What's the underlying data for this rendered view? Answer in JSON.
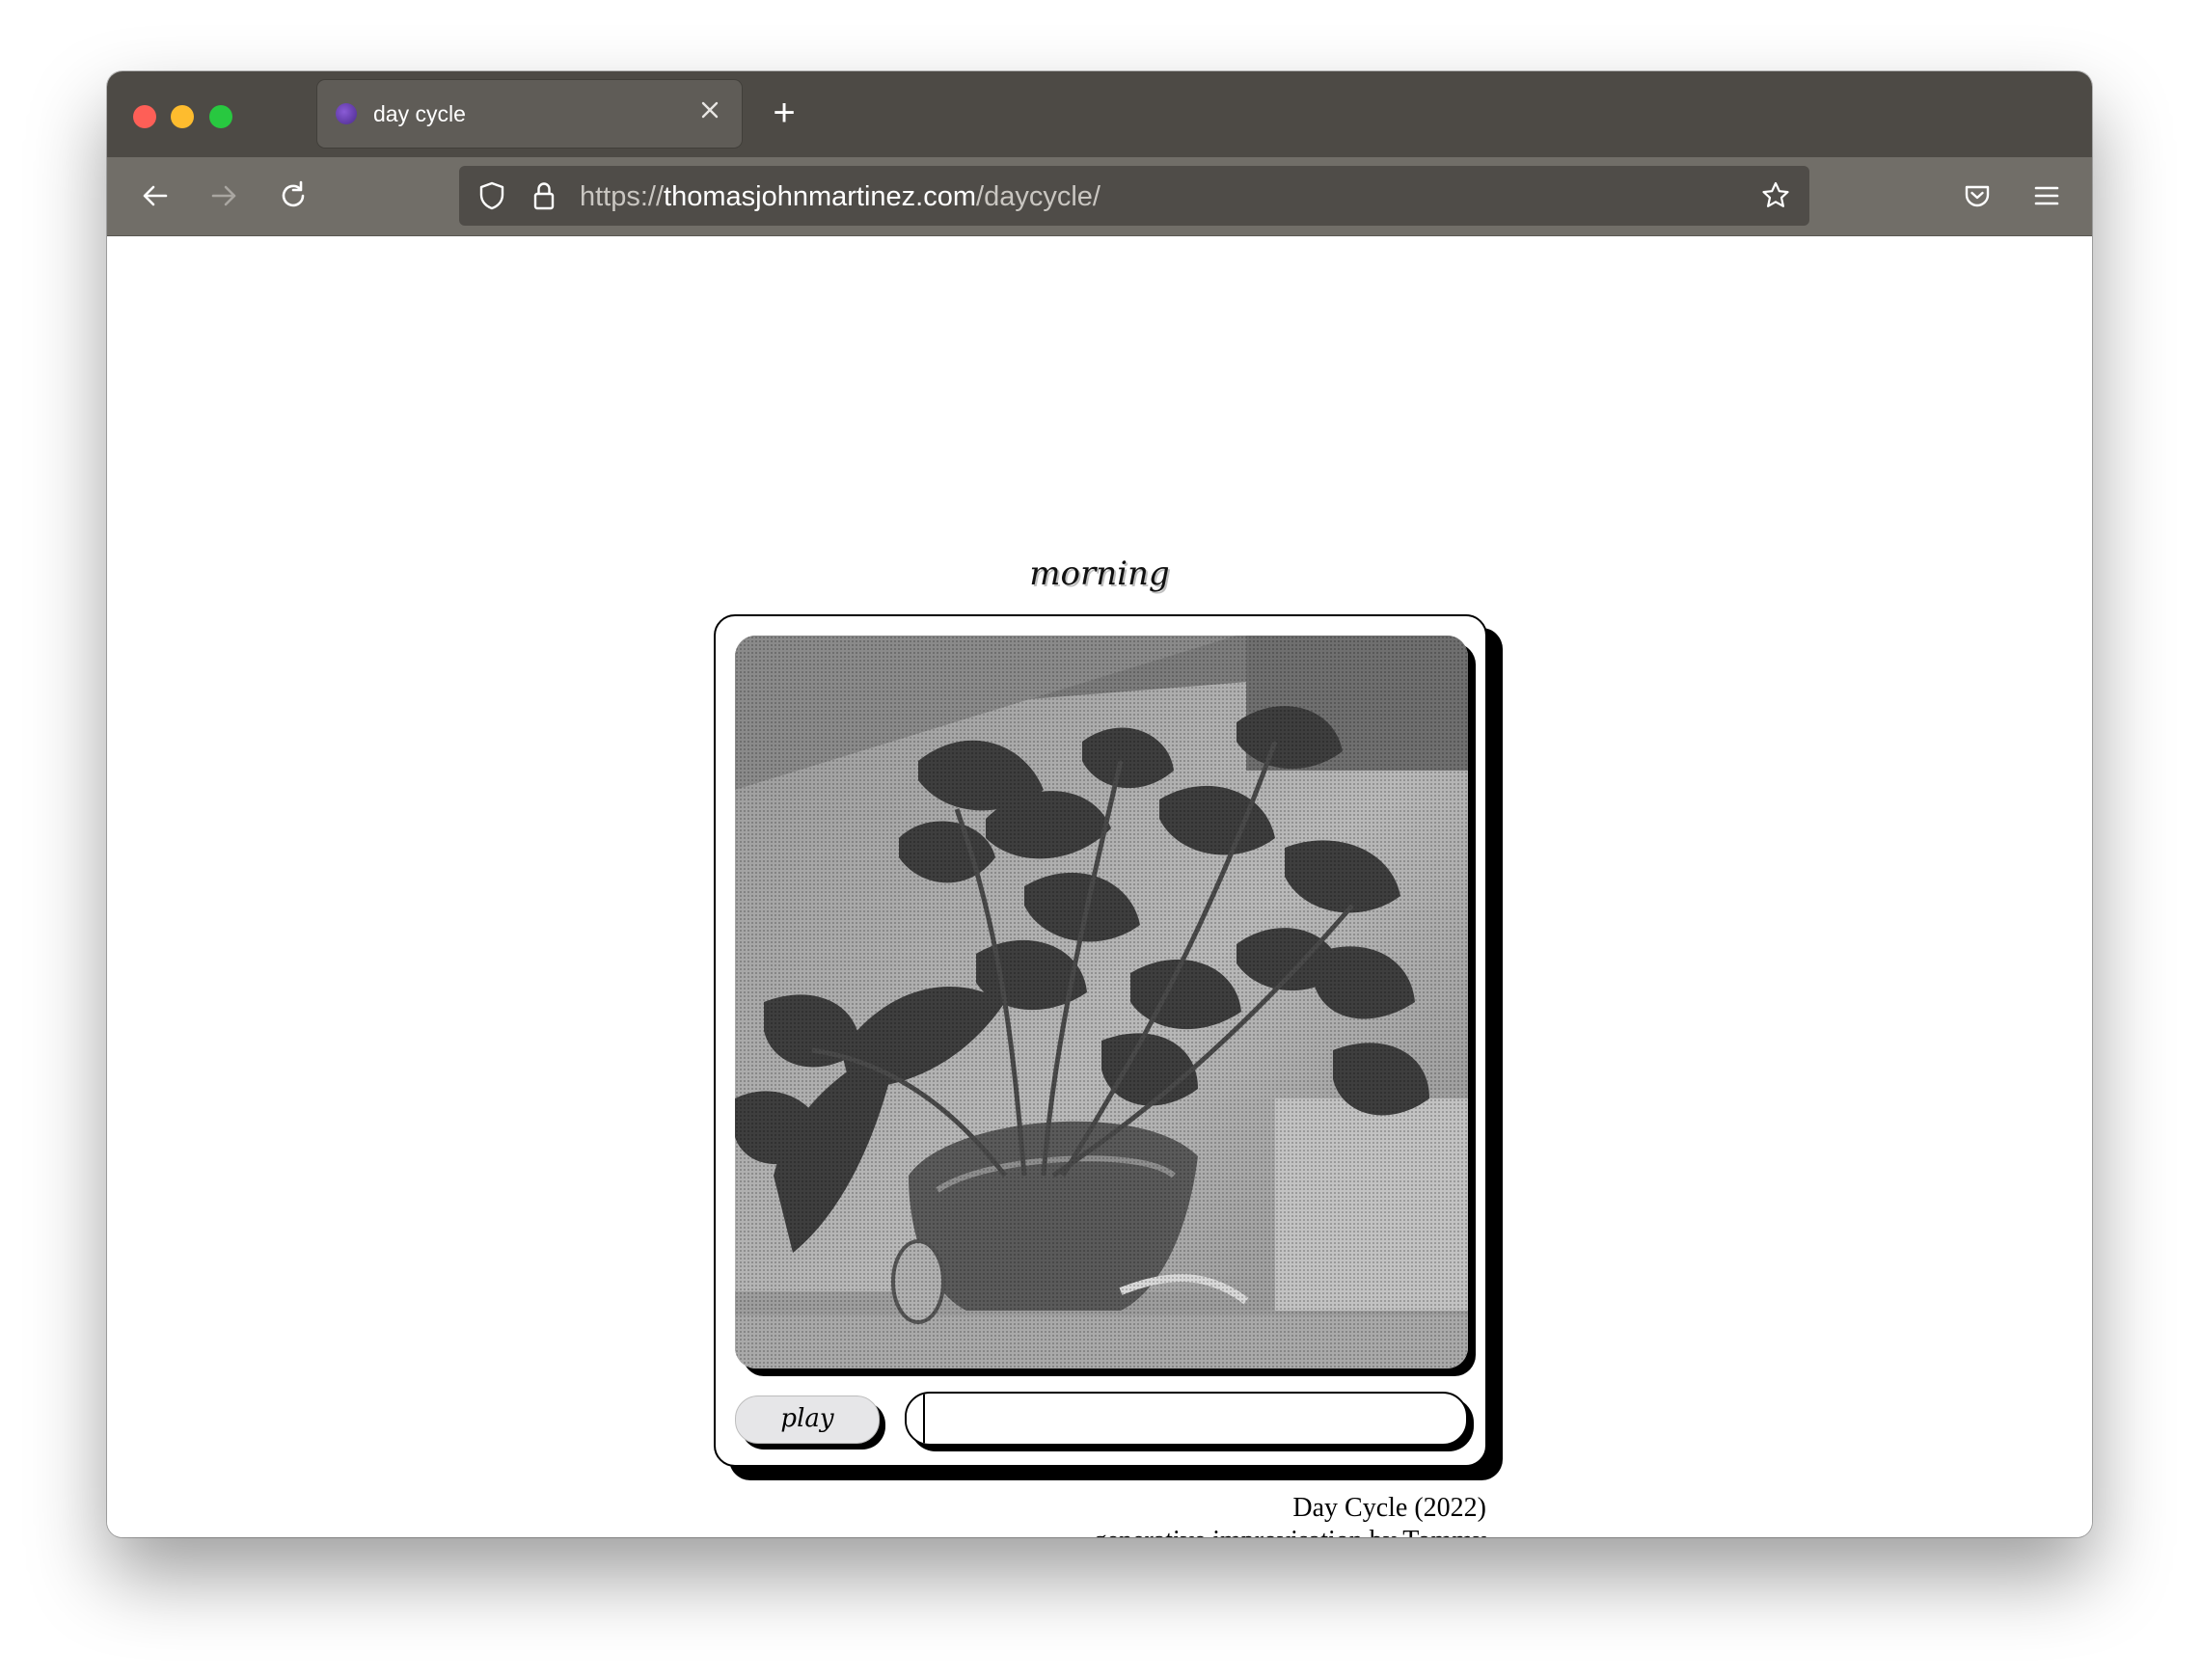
{
  "browser": {
    "tab": {
      "title": "day cycle",
      "close_icon": "close-icon",
      "favicon": "site-favicon"
    },
    "new_tab_label": "+",
    "url": {
      "scheme": "https://",
      "host": "thomasjohnmartinez.com",
      "path": "/daycycle/"
    },
    "icons": [
      "back-arrow-icon",
      "forward-arrow-icon",
      "reload-icon",
      "shield-icon",
      "lock-icon",
      "bookmark-star-icon",
      "pocket-icon",
      "menu-icon"
    ],
    "colors": {
      "tabbar": "#4d4a45",
      "navbar": "#716e68",
      "urlbar": "#4f4c48"
    }
  },
  "page": {
    "stage_title": "morning",
    "play_label": "play",
    "progress": 0.03,
    "caption": {
      "line1": "Day Cycle (2022)",
      "line2": "generative improvisation by Tommy"
    }
  }
}
